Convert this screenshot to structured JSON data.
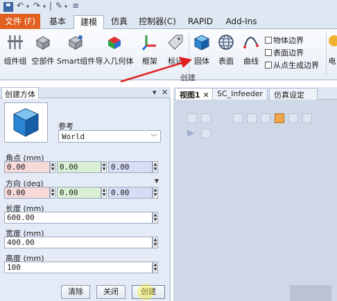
{
  "qat": {
    "undo_icon": "undo-icon",
    "redo_icon": "redo-icon",
    "separator": "|"
  },
  "tabs": [
    {
      "label": "文件 (F)"
    },
    {
      "label": "基本"
    },
    {
      "label": "建模"
    },
    {
      "label": "仿真"
    },
    {
      "label": "控制器(C)"
    },
    {
      "label": "RAPID"
    },
    {
      "label": "Add-Ins"
    }
  ],
  "ribbon": {
    "buttons": [
      {
        "label": "组件组"
      },
      {
        "label": "空部件"
      },
      {
        "label": "Smart组件"
      },
      {
        "label": "导入几何体"
      },
      {
        "label": "框架"
      },
      {
        "label": "标记"
      },
      {
        "label": "固体"
      },
      {
        "label": "表面"
      },
      {
        "label": "曲线"
      },
      {
        "label": "电"
      }
    ],
    "small_items": [
      {
        "label": "物体边界"
      },
      {
        "label": "表面边界"
      },
      {
        "label": "从点生成边界"
      }
    ],
    "group_label": "创建"
  },
  "panel": {
    "title": "创建方体",
    "pin": "▾",
    "close": "✕",
    "reference_label": "参考",
    "reference_value": "World",
    "corner_label": "角点 (mm)",
    "corner": [
      "0.00",
      "0.00",
      "0.00"
    ],
    "orientation_label": "方向 (deg)",
    "orientation": [
      "0.00",
      "0.00",
      "0.00"
    ],
    "length_label": "长度 (mm)",
    "length": "600.00",
    "width_label": "宽度 (mm)",
    "width": "400.00",
    "height_label": "高度 (mm)",
    "height": "100",
    "buttons": {
      "clear": "清除",
      "close": "关闭",
      "create": "创建"
    }
  },
  "views": {
    "tabs": [
      {
        "label": "视图1"
      },
      {
        "label": "SC_Infeeder"
      },
      {
        "label": "仿真设定"
      }
    ],
    "close": "✕"
  },
  "colors": {
    "file_tab": "#e06020",
    "arrow": "#e02020",
    "cube": "#1f7fd0"
  }
}
